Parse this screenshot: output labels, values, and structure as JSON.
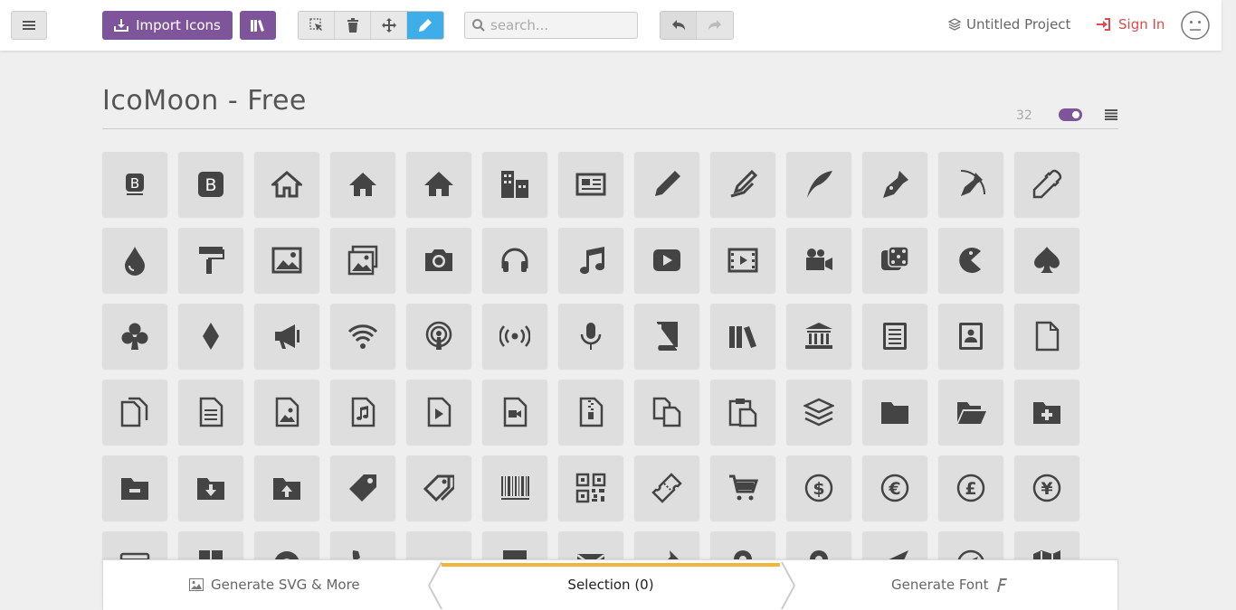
{
  "toolbar": {
    "import_label": "Import Icons",
    "search_placeholder": "search...",
    "project_name": "Untitled Project",
    "signin_label": "Sign In"
  },
  "icon_set": {
    "title": "IcoMoon - Free",
    "count": "32"
  },
  "colors": {
    "accent_purple": "#7e559b",
    "active_blue": "#3daee9",
    "signin_red": "#e04a4a",
    "progress_orange": "#f4b43c"
  },
  "icons": [
    "bootstrap-icon",
    "bootstrap-square-icon",
    "home-icon",
    "home2-icon",
    "home3-icon",
    "office-icon",
    "newspaper-icon",
    "pencil-icon",
    "pencil2-icon",
    "quill-icon",
    "pen-icon",
    "blog-icon",
    "eyedropper-icon",
    "droplet-icon",
    "paint-format-icon",
    "image-icon",
    "images-icon",
    "camera-icon",
    "headphones-icon",
    "music-icon",
    "play-icon",
    "film-icon",
    "video-camera-icon",
    "dice-icon",
    "pacman-icon",
    "spades-icon",
    "clubs-icon",
    "diamonds-icon",
    "bullhorn-icon",
    "connection-icon",
    "podcast-icon",
    "feed-icon",
    "mic-icon",
    "book-icon",
    "books-icon",
    "library-icon",
    "file-text-icon",
    "profile-icon",
    "file-empty-icon",
    "files-empty-icon",
    "file-text2-icon",
    "file-picture-icon",
    "file-music-icon",
    "file-play-icon",
    "file-video-icon",
    "file-zip-icon",
    "copy-icon",
    "paste-icon",
    "stack-icon",
    "folder-icon",
    "folder-open-icon",
    "folder-plus-icon",
    "folder-minus-icon",
    "folder-download-icon",
    "folder-upload-icon",
    "price-tag-icon",
    "price-tags-icon",
    "barcode-icon",
    "qrcode-icon",
    "ticket-icon",
    "cart-icon",
    "coin-dollar-icon",
    "coin-euro-icon",
    "coin-pound-icon",
    "coin-yen-icon",
    "credit-card-icon",
    "calculator-icon",
    "lifebuoy-icon",
    "phone-icon",
    "phone-hang-up-icon",
    "address-book-icon",
    "envelop-icon",
    "pushpin-icon",
    "location-icon",
    "location2-icon",
    "compass-icon",
    "compass2-icon",
    "map-icon"
  ],
  "bottom": {
    "generate_svg": "Generate SVG & More",
    "selection": "Selection (0)",
    "generate_font": "Generate Font"
  }
}
